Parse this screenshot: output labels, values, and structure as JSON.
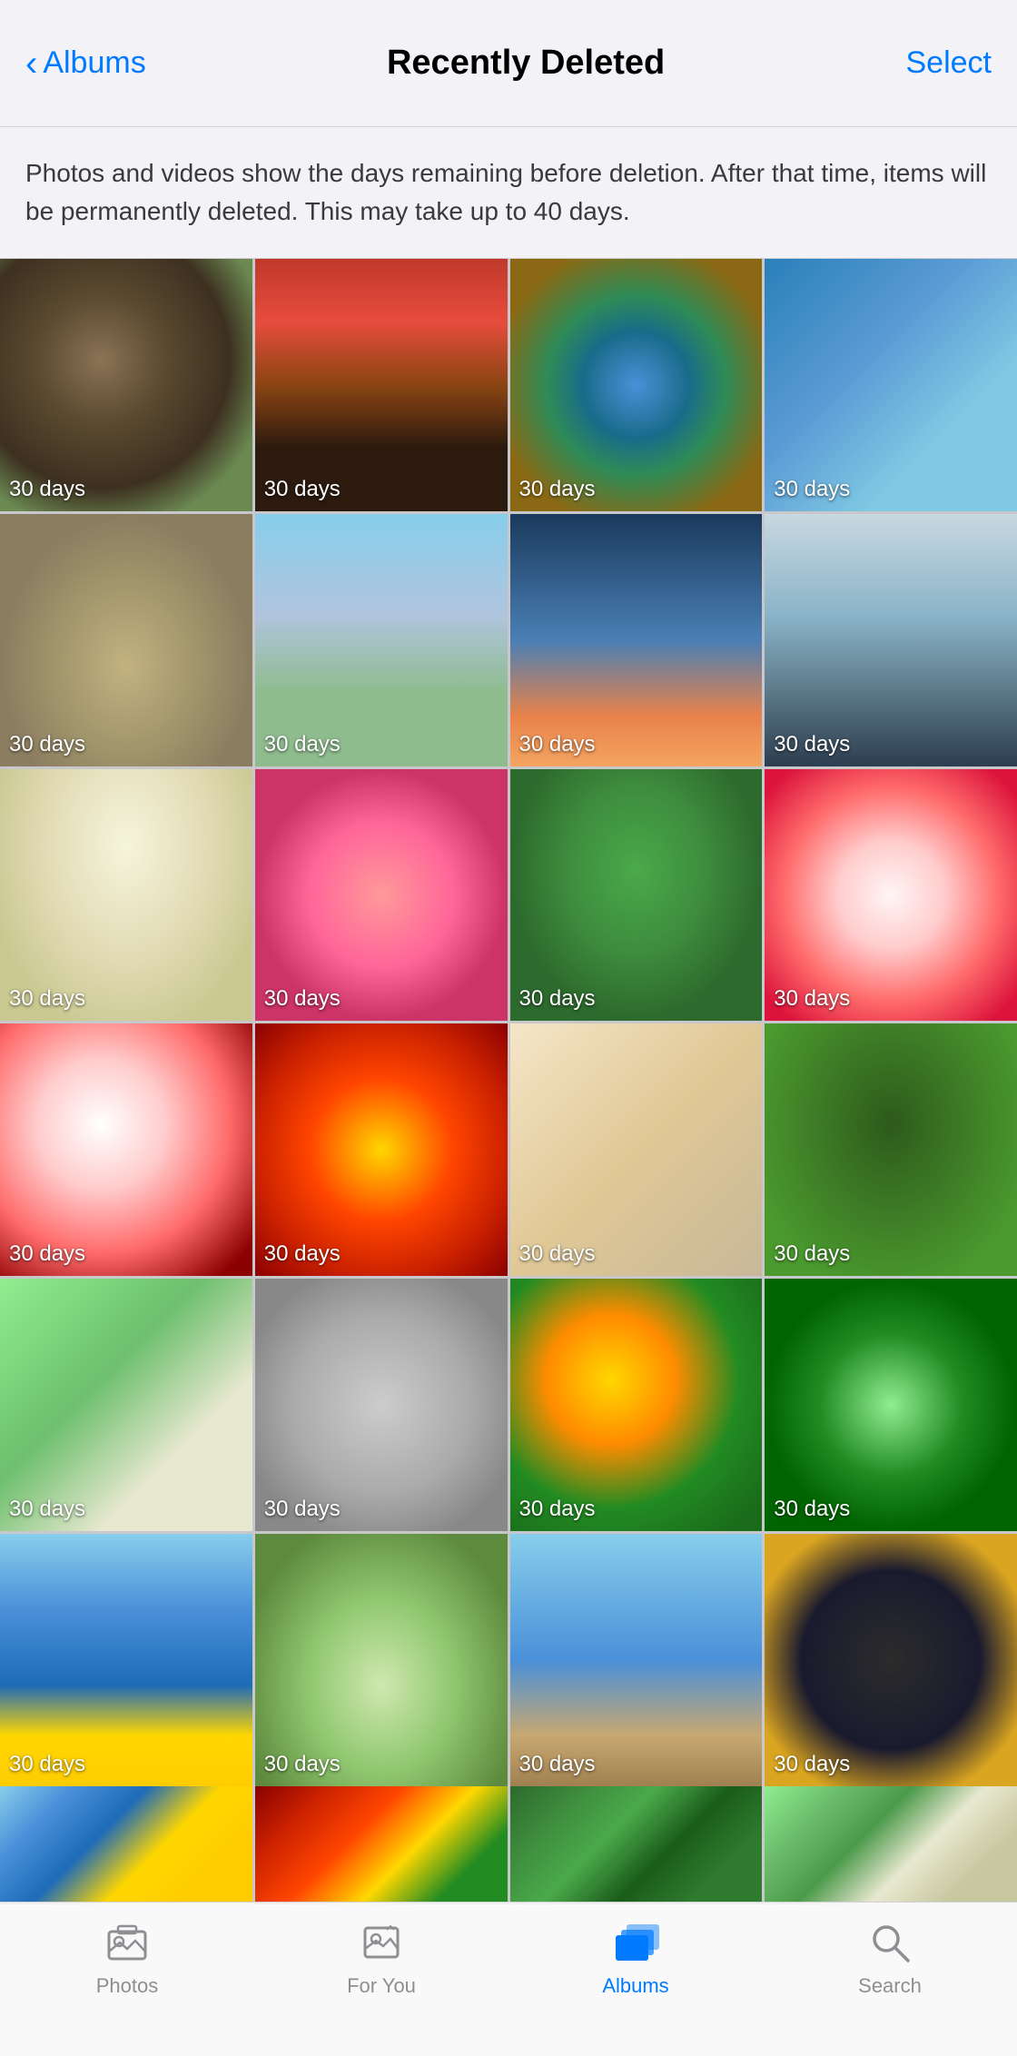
{
  "header": {
    "back_label": "Albums",
    "title": "Recently Deleted",
    "select_label": "Select"
  },
  "info": {
    "text": "Photos and videos show the days remaining before deletion. After that time, items will be permanently deleted. This may take up to 40 days."
  },
  "photos": [
    {
      "id": 1,
      "days": "30 days",
      "color_class": "p1"
    },
    {
      "id": 2,
      "days": "30 days",
      "color_class": "p2"
    },
    {
      "id": 3,
      "days": "30 days",
      "color_class": "p3"
    },
    {
      "id": 4,
      "days": "30 days",
      "color_class": "p4"
    },
    {
      "id": 5,
      "days": "30 days",
      "color_class": "p5"
    },
    {
      "id": 6,
      "days": "30 days",
      "color_class": "p6"
    },
    {
      "id": 7,
      "days": "30 days",
      "color_class": "p7"
    },
    {
      "id": 8,
      "days": "30 days",
      "color_class": "p8"
    },
    {
      "id": 9,
      "days": "30 days",
      "color_class": "p9"
    },
    {
      "id": 10,
      "days": "30 days",
      "color_class": "p10"
    },
    {
      "id": 11,
      "days": "30 days",
      "color_class": "p11"
    },
    {
      "id": 12,
      "days": "30 days",
      "color_class": "p12"
    },
    {
      "id": 13,
      "days": "30 days",
      "color_class": "p13"
    },
    {
      "id": 14,
      "days": "30 days",
      "color_class": "p14"
    },
    {
      "id": 15,
      "days": "30 days",
      "color_class": "p15"
    },
    {
      "id": 16,
      "days": "30 days",
      "color_class": "p16"
    },
    {
      "id": 17,
      "days": "30 days",
      "color_class": "p17"
    },
    {
      "id": 18,
      "days": "30 days",
      "color_class": "p18"
    },
    {
      "id": 19,
      "days": "30 days",
      "color_class": "p19"
    },
    {
      "id": 20,
      "days": "30 days",
      "color_class": "p20"
    },
    {
      "id": 21,
      "days": "30 days",
      "color_class": "p21"
    },
    {
      "id": 22,
      "days": "30 days",
      "color_class": "p22"
    },
    {
      "id": 23,
      "days": "30 days",
      "color_class": "p23"
    },
    {
      "id": 24,
      "days": "30 days",
      "color_class": "p24"
    }
  ],
  "partial_photos": [
    {
      "id": 25,
      "color_class": "p21"
    },
    {
      "id": 26,
      "color_class": "p14"
    },
    {
      "id": 27,
      "color_class": "p11"
    },
    {
      "id": 28,
      "color_class": "p17"
    }
  ],
  "nav": {
    "items": [
      {
        "id": "photos",
        "label": "Photos",
        "active": false
      },
      {
        "id": "for-you",
        "label": "For You",
        "active": false
      },
      {
        "id": "albums",
        "label": "Albums",
        "active": true
      },
      {
        "id": "search",
        "label": "Search",
        "active": false
      }
    ]
  },
  "days_label": "30 days"
}
